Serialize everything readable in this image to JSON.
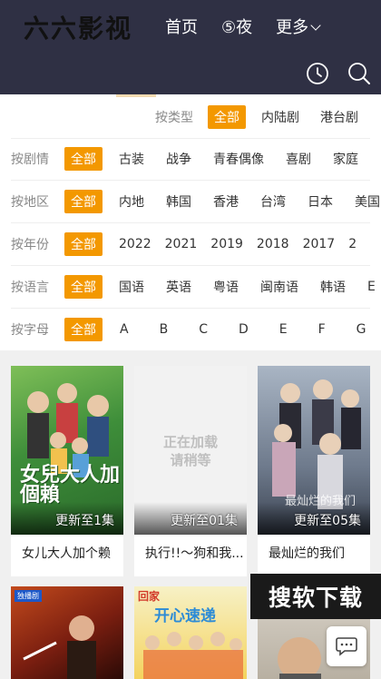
{
  "header": {
    "logo": "六六影视",
    "nav": [
      {
        "label": "首页"
      },
      {
        "label": "⑤夜"
      },
      {
        "label": "更多"
      }
    ],
    "icons": [
      "history-icon",
      "search-icon"
    ]
  },
  "filters": {
    "type": {
      "label": "按类型",
      "options": [
        "全部",
        "内陆剧",
        "港台剧"
      ],
      "selected": "全部"
    },
    "plot": {
      "label": "按剧情",
      "options": [
        "全部",
        "古装",
        "战争",
        "青春偶像",
        "喜剧",
        "家庭"
      ],
      "selected": "全部"
    },
    "region": {
      "label": "按地区",
      "options": [
        "全部",
        "内地",
        "韩国",
        "香港",
        "台湾",
        "日本",
        "美国"
      ],
      "selected": "全部"
    },
    "year": {
      "label": "按年份",
      "options": [
        "全部",
        "2022",
        "2021",
        "2019",
        "2018",
        "2017",
        "2"
      ],
      "selected": "全部"
    },
    "language": {
      "label": "按语言",
      "options": [
        "全部",
        "国语",
        "英语",
        "粤语",
        "闽南语",
        "韩语",
        "E"
      ],
      "selected": "全部"
    },
    "letter": {
      "label": "按字母",
      "options": [
        "全部",
        "A",
        "B",
        "C",
        "D",
        "E",
        "F",
        "G"
      ],
      "selected": "全部"
    }
  },
  "cards": [
    {
      "title": "女儿大人加个赖",
      "update": "更新至1集",
      "poster_text": "女兒大人加個賴",
      "accent": "#3e8e3a"
    },
    {
      "title": "执行!!～狗和我...",
      "update": "更新至01集",
      "poster_text_1": "正在加载",
      "poster_text_2": "请稍等"
    },
    {
      "title": "最灿烂的我们",
      "update": "更新至05集",
      "poster_text": "最灿烂的我们"
    },
    {
      "title": "",
      "update": "",
      "badge": "独播剧"
    },
    {
      "title": "",
      "update": "",
      "poster_text": "开心速递",
      "poster_text_2": "回家"
    },
    {
      "title": "",
      "update": ""
    }
  ],
  "watermark": "搜软下载",
  "colors": {
    "header": "#2f3044",
    "accent": "#f39800"
  }
}
